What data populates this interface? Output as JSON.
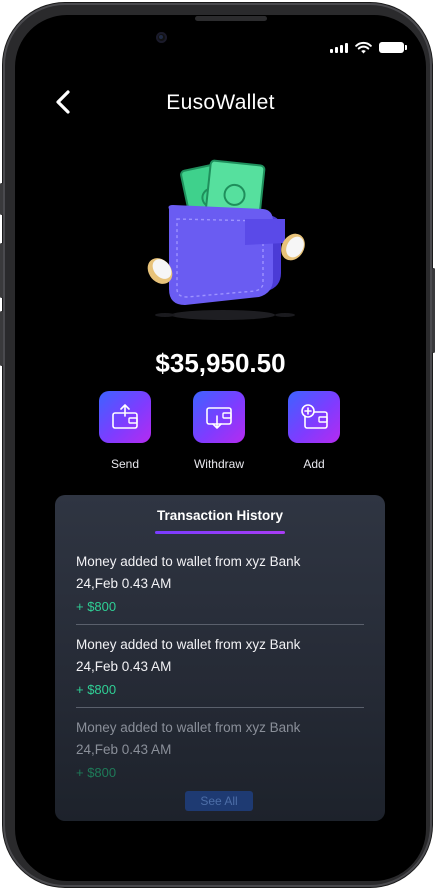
{
  "app": {
    "title": "EusoWallet"
  },
  "wallet": {
    "balance": "$35,950.50"
  },
  "actions": [
    {
      "label": "Send",
      "icon": "send-icon"
    },
    {
      "label": "Withdraw",
      "icon": "withdraw-icon"
    },
    {
      "label": "Add",
      "icon": "add-money-icon"
    }
  ],
  "history": {
    "title": "Transaction History",
    "items": [
      {
        "description": "Money added to wallet from xyz Bank",
        "date": "24,Feb 0.43 AM",
        "amount": "+ $800"
      },
      {
        "description": "Money added to wallet from xyz Bank",
        "date": "24,Feb 0.43 AM",
        "amount": "+ $800"
      },
      {
        "description": "Money added to wallet from xyz Bank",
        "date": "24,Feb 0.43 AM",
        "amount": "+ $800"
      }
    ],
    "see_all_label": "See All"
  },
  "colors": {
    "accent_start": "#3d63ff",
    "accent_end": "#b52bf0",
    "positive": "#2fcf95",
    "background": "#000000"
  }
}
